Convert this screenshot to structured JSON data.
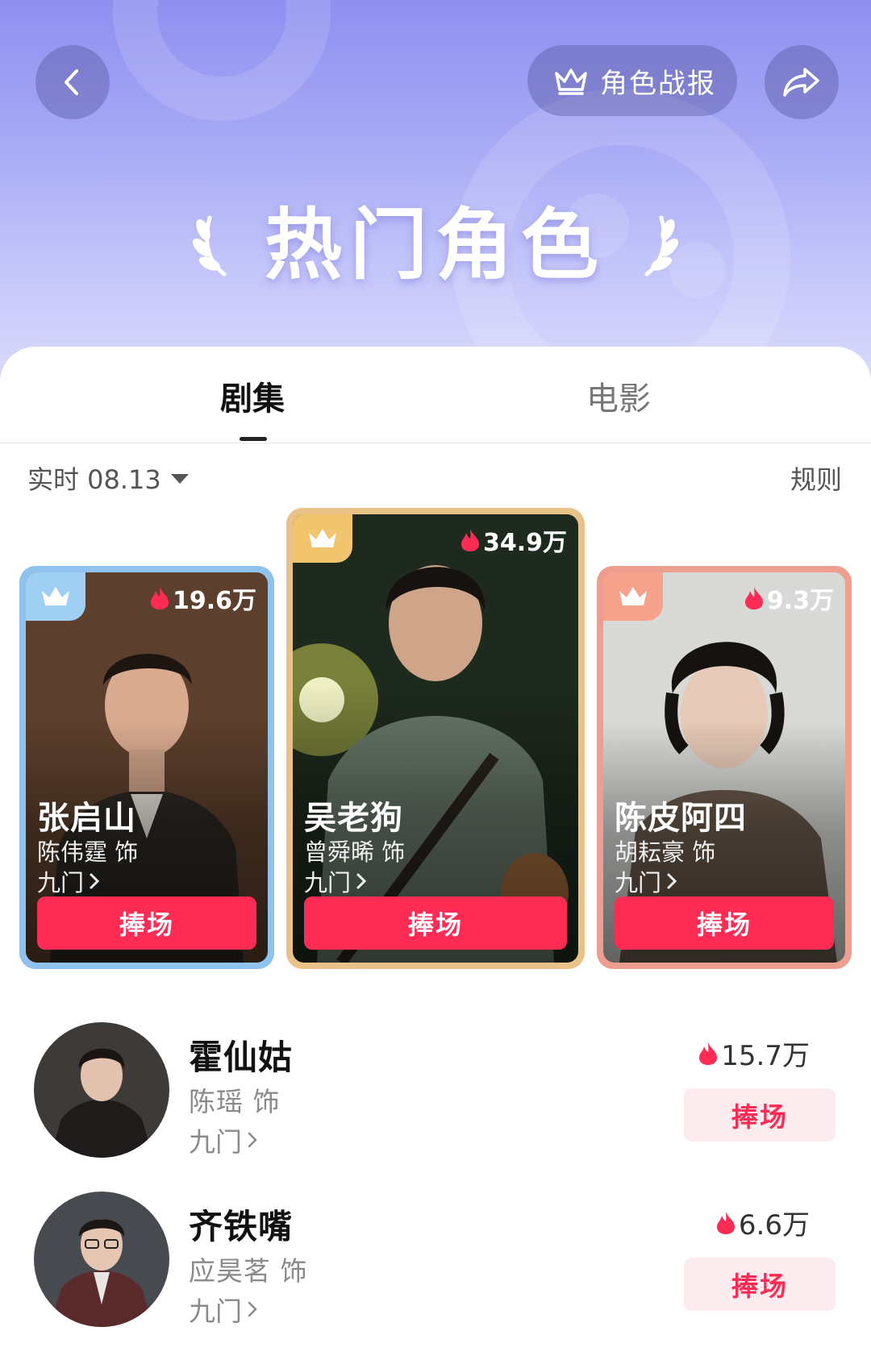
{
  "header": {
    "report_label": "角色战报",
    "page_title": "热门角色"
  },
  "tabs": [
    {
      "label": "剧集",
      "active": true
    },
    {
      "label": "电影",
      "active": false
    }
  ],
  "filter": {
    "label": "实时 08.13",
    "rules_label": "规则"
  },
  "top_cards": [
    {
      "rank": 2,
      "heat": "19.6万",
      "character": "张启山",
      "actor": "陈伟霆 饰",
      "show": "九门",
      "cheer_label": "捧场",
      "accent": "#8fc2ec"
    },
    {
      "rank": 1,
      "heat": "34.9万",
      "character": "吴老狗",
      "actor": "曾舜晞 饰",
      "show": "九门",
      "cheer_label": "捧场",
      "accent": "#e8c289"
    },
    {
      "rank": 3,
      "heat": "9.3万",
      "character": "陈皮阿四",
      "actor": "胡耘豪 饰",
      "show": "九门",
      "cheer_label": "捧场",
      "accent": "#ee9e8f"
    }
  ],
  "list": [
    {
      "character": "霍仙姑",
      "actor": "陈瑶 饰",
      "show": "九门",
      "heat": "15.7万",
      "cheer_label": "捧场"
    },
    {
      "character": "齐铁嘴",
      "actor": "应昊茗 饰",
      "show": "九门",
      "heat": "6.6万",
      "cheer_label": "捧场"
    }
  ],
  "colors": {
    "cheer": "#fe2c55",
    "cheer_light": "#fdecef",
    "header_top": "#8f8ff0"
  }
}
